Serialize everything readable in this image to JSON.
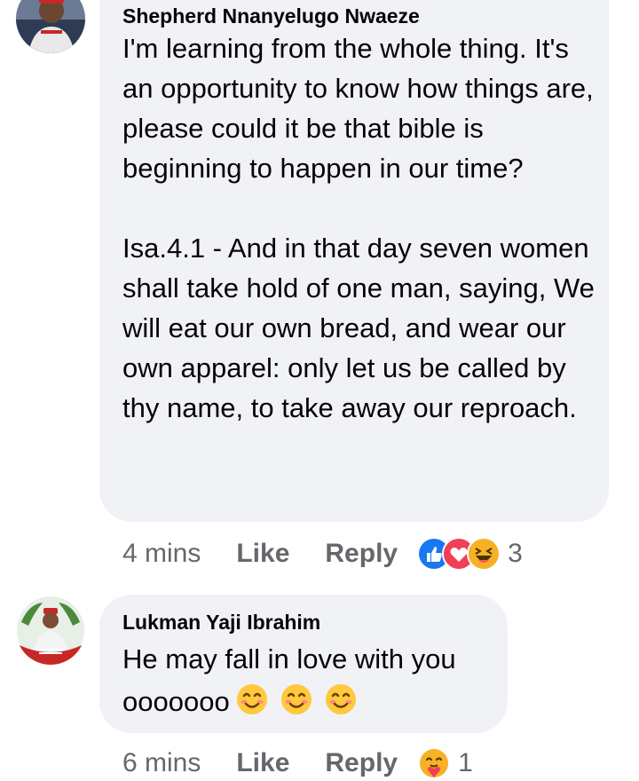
{
  "comments": [
    {
      "author": "Shepherd Nnanyelugo Nwaeze",
      "text": "I'm learning from the whole thing. It's an opportunity to know how things are, please could it be that bible is beginning to happen in our time?\n\nIsa.4.1 - And in that day seven women shall take hold of one man, saying, We will eat our own bread, and wear our own apparel: only let us be called by thy name, to take away our reproach.",
      "time": "4 mins",
      "like_label": "Like",
      "reply_label": "Reply",
      "reaction_icons": [
        "like-icon",
        "love-icon",
        "haha-icon"
      ],
      "reaction_count": "3"
    },
    {
      "author": "Lukman Yaji Ibrahim",
      "text_line1": "He may fall in love with you",
      "text_line2": "ooooooo",
      "emojis": [
        "smiling-face-icon",
        "smiling-face-icon",
        "smiling-face-icon"
      ],
      "time": "6 mins",
      "like_label": "Like",
      "reply_label": "Reply",
      "reaction_icons": [
        "care-icon"
      ],
      "reaction_count": "1"
    }
  ],
  "colors": {
    "bubble": "#f0f2f5",
    "meta_text": "#65676b",
    "like_blue": "#1877f2",
    "love_red": "#f33e58",
    "haha_yellow": "#f7b125"
  }
}
